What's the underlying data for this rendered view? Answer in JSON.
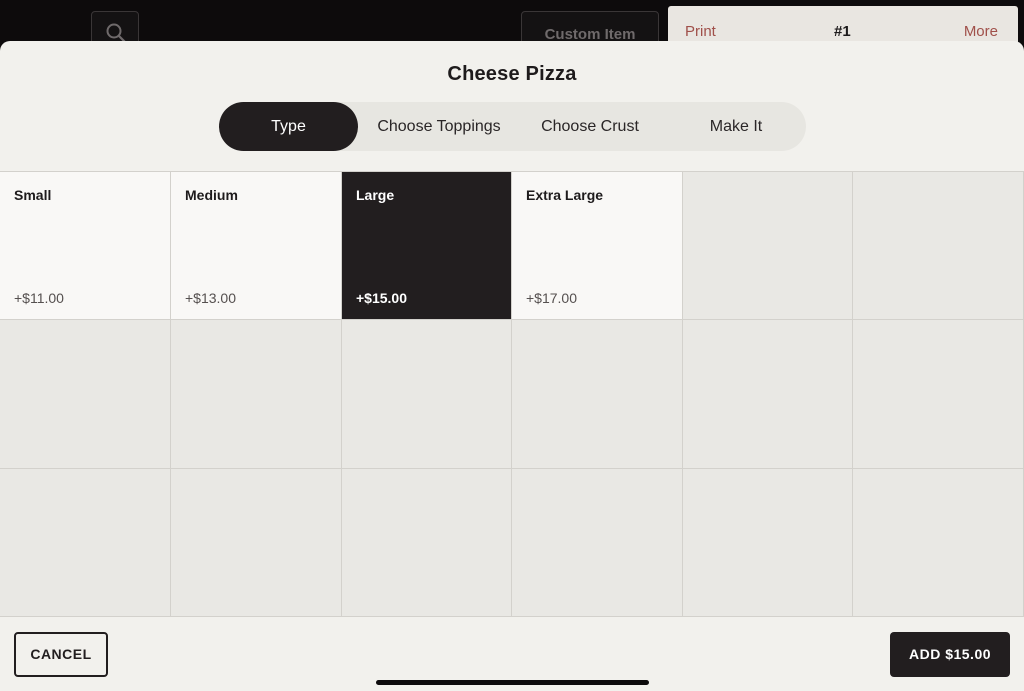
{
  "background": {
    "custom_item_label": "Custom Item",
    "ticket": {
      "print_label": "Print",
      "number": "#1",
      "more_label": "More"
    }
  },
  "modal": {
    "title": "Cheese Pizza",
    "tabs": [
      {
        "label": "Type",
        "active": true
      },
      {
        "label": "Choose Toppings",
        "active": false
      },
      {
        "label": "Choose Crust",
        "active": false
      },
      {
        "label": "Make It",
        "active": false
      }
    ],
    "options": [
      {
        "name": "Small",
        "price": "+$11.00",
        "selected": false
      },
      {
        "name": "Medium",
        "price": "+$13.00",
        "selected": false
      },
      {
        "name": "Large",
        "price": "+$15.00",
        "selected": true
      },
      {
        "name": "Extra Large",
        "price": "+$17.00",
        "selected": false
      }
    ],
    "cancel_label": "CANCEL",
    "add_label": "ADD $15.00"
  },
  "colors": {
    "dark": "#221e1f",
    "sheet_bg": "#f2f1ed",
    "option_bg": "#f9f8f6",
    "empty_cell_bg": "#e9e8e4",
    "accent_red": "#a0504a"
  },
  "icons": {
    "search": "search-icon"
  }
}
